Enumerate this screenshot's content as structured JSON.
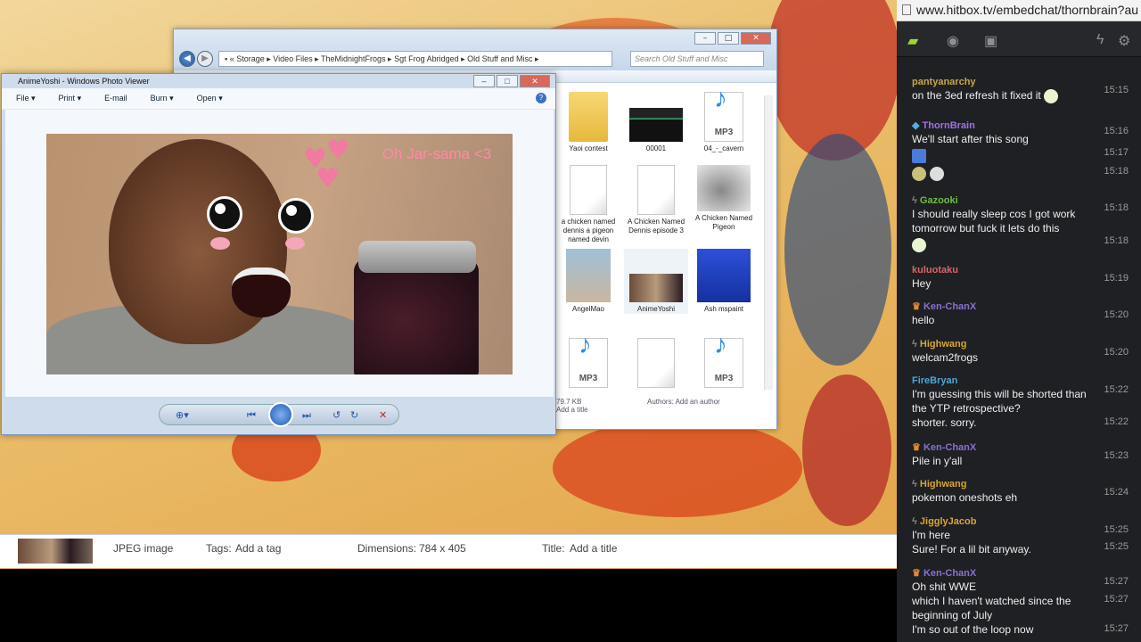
{
  "explorer": {
    "breadcrumb": [
      "Storage",
      "Video Files",
      "TheMidnightFrogs",
      "Sgt Frog Abridged",
      "Old Stuff and Misc"
    ],
    "search_placeholder": "Search Old Stuff and Misc",
    "files": [
      {
        "name": "Yaoi contest",
        "type": "folder"
      },
      {
        "name": "00001",
        "type": "image"
      },
      {
        "name": "04_-_cavern",
        "type": "mp3"
      },
      {
        "name": "a chicken named dennis a pigeon named devin",
        "type": "doc"
      },
      {
        "name": "A Chicken Named Dennis episode 3",
        "type": "doc"
      },
      {
        "name": "A Chicken Named Pigeon",
        "type": "image"
      },
      {
        "name": "AngelMao",
        "type": "image"
      },
      {
        "name": "AnimeYoshi",
        "type": "image"
      },
      {
        "name": "Ash mspaint",
        "type": "image"
      },
      {
        "name": "",
        "type": "mp3"
      },
      {
        "name": "",
        "type": "doc"
      },
      {
        "name": "",
        "type": "mp3"
      }
    ],
    "mp3_label": "MP3",
    "footer_size": "79.7 KB",
    "footer_title": "Add a title",
    "footer_authors_label": "Authors:",
    "footer_authors_value": "Add an author"
  },
  "photo_viewer": {
    "title": "AnimeYoshi - Windows Photo Viewer",
    "menu": [
      "File",
      "Print",
      "E-mail",
      "Burn",
      "Open"
    ],
    "photo_caption": "Oh Jar-sama <3"
  },
  "infobar": {
    "type": "JPEG image",
    "tags_label": "Tags:",
    "tags_value": "Add a tag",
    "dims_label": "Dimensions:",
    "dims_value": "784 x 405",
    "title_label": "Title:",
    "title_value": "Add a title"
  },
  "chat": {
    "url": "www.hitbox.tv/embedchat/thornbrain?au",
    "messages": [
      {
        "user": "pantyanarchy",
        "color": "#c8a84a",
        "text": "on the 3ed refresh it fixed it",
        "time": "15:15"
      },
      {
        "user": "ThornBrain",
        "color": "#a071e8",
        "text": "We'll start after this song",
        "time": "15:16"
      },
      {
        "user": "",
        "color": "#fff",
        "text": "",
        "time": "15:17"
      },
      {
        "user": "",
        "color": "#fff",
        "text": "",
        "time": "15:18"
      },
      {
        "user": "Gazooki",
        "color": "#6fbe44",
        "text": "I should really sleep cos I got work tomorrow but fuck it lets do this",
        "time": "15:18"
      },
      {
        "user": "",
        "color": "#fff",
        "text": "",
        "time": "15:18"
      },
      {
        "user": "kuluotaku",
        "color": "#d46868",
        "text": "Hey",
        "time": "15:19"
      },
      {
        "user": "Ken-ChanX",
        "color": "#8a6fd1",
        "text": "hello",
        "time": "15:20"
      },
      {
        "user": "Highwang",
        "color": "#d7a536",
        "text": "welcam2frogs",
        "time": "15:20"
      },
      {
        "user": "FireBryan",
        "color": "#4aa7d9",
        "text": "I'm guessing this will be shorted than the YTP retrospective?",
        "time": "15:22"
      },
      {
        "user": "",
        "color": "#fff",
        "text": "shorter. sorry.",
        "time": "15:22"
      },
      {
        "user": "Ken-ChanX",
        "color": "#8a6fd1",
        "text": "Pile in y'all",
        "time": "15:23"
      },
      {
        "user": "Highwang",
        "color": "#d7a536",
        "text": "pokemon oneshots eh",
        "time": "15:24"
      },
      {
        "user": "JigglyJacob",
        "color": "#d7a536",
        "text": "I'm here",
        "time": "15:25"
      },
      {
        "user": "",
        "color": "#fff",
        "text": "Sure! For a lil bit anyway.",
        "time": "15:25"
      },
      {
        "user": "Ken-ChanX",
        "color": "#8a6fd1",
        "text": "Oh shit WWE",
        "time": "15:27"
      },
      {
        "user": "",
        "color": "#fff",
        "text": "which I haven't watched since the beginning of July",
        "time": "15:27"
      },
      {
        "user": "",
        "color": "#fff",
        "text": "I'm so out of the loop now",
        "time": "15:27"
      }
    ]
  }
}
